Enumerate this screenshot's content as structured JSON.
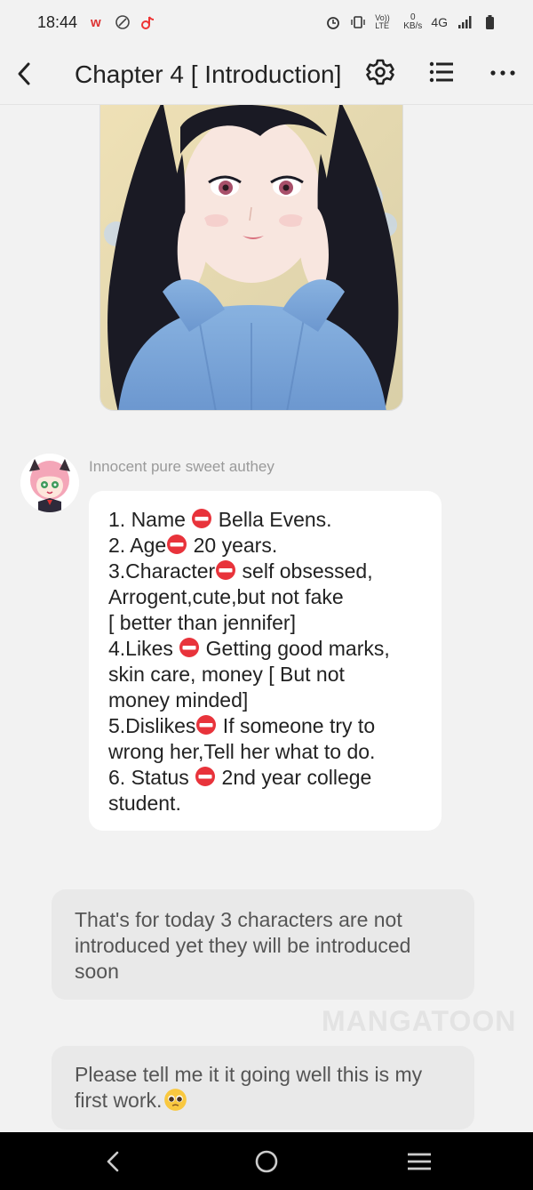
{
  "status_bar": {
    "time": "18:44",
    "network": "4G",
    "speed_value": "0",
    "speed_unit": "KB/s",
    "volte": "Vo)) LTE"
  },
  "header": {
    "title": "Chapter 4 [ Introduction]"
  },
  "author": {
    "name": "Innocent pure sweet authey"
  },
  "intro_lines": [
    {
      "pre": "1. Name ",
      "emoji": true,
      "post": " Bella Evens."
    },
    {
      "pre": "2. Age",
      "emoji": true,
      "post": " 20 years."
    },
    {
      "pre": "3.Character",
      "emoji": true,
      "post": " self obsessed,"
    },
    {
      "pre": "Arrogent,cute,but not fake",
      "emoji": false,
      "post": ""
    },
    {
      "pre": "[ better than jennifer]",
      "emoji": false,
      "post": ""
    },
    {
      "pre": "4.Likes ",
      "emoji": true,
      "post": " Getting good marks,"
    },
    {
      "pre": "skin care, money [ But not",
      "emoji": false,
      "post": ""
    },
    {
      "pre": "money minded]",
      "emoji": false,
      "post": ""
    },
    {
      "pre": "5.Dislikes",
      "emoji": true,
      "post": " If someone try to"
    },
    {
      "pre": "wrong her,Tell her what to do.",
      "emoji": false,
      "post": ""
    },
    {
      "pre": "6. Status ",
      "emoji": true,
      "post": " 2nd year college"
    },
    {
      "pre": "student.",
      "emoji": false,
      "post": ""
    }
  ],
  "message1": {
    "lines": [
      "That's for today 3 characters are not",
      "introduced yet they will be introduced",
      "soon"
    ]
  },
  "message2": {
    "lines": [
      "Please tell me it it going well this is my",
      "first work."
    ]
  },
  "watermark": "MANGATOON",
  "colors": {
    "background": "#f2f2f2",
    "bubble_white": "#ffffff",
    "bubble_grey": "#e9e9e9",
    "emoji_red": "#e8333b"
  }
}
